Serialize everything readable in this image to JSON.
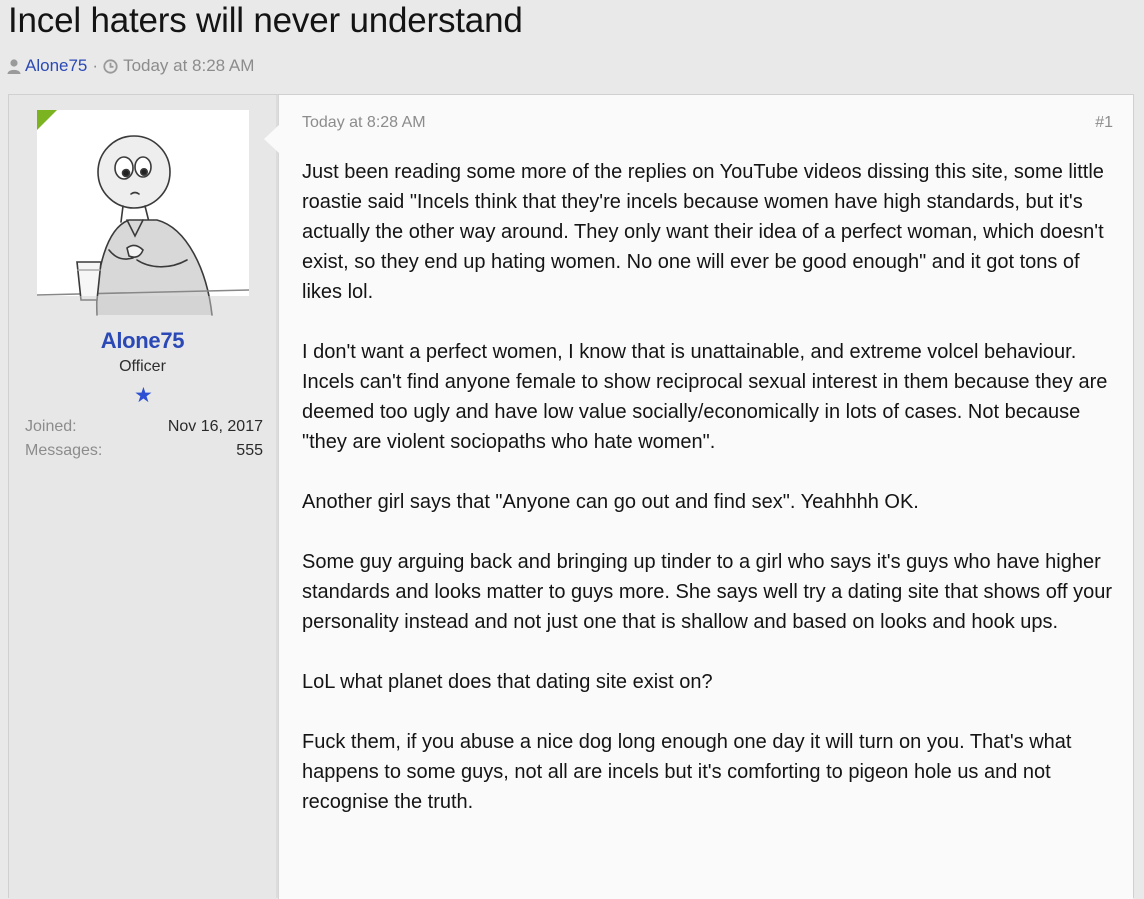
{
  "thread": {
    "title": "Incel haters will never understand",
    "author": "Alone75",
    "separator": "·",
    "date": "Today at 8:28 AM"
  },
  "user_panel": {
    "username": "Alone75",
    "user_title": "Officer",
    "rank_star": "★",
    "joined_label": "Joined:",
    "joined_value": "Nov 16, 2017",
    "messages_label": "Messages:",
    "messages_value": "555",
    "online_color": "#7bb321"
  },
  "post": {
    "date": "Today at 8:28 AM",
    "number": "#1",
    "paragraphs": [
      "Just been reading some more of the replies on YouTube videos dissing this site, some little roastie said \"Incels think that they're incels because women have high standards, but it's actually the other way around. They only want their idea of a perfect woman, which doesn't exist, so they end up hating women. No one will ever be good enough\" and it got tons of likes lol.",
      "I don't want a perfect women, I know that is unattainable, and extreme volcel behaviour. Incels can't find anyone female to show reciprocal sexual interest in them because they are deemed too ugly and have low value socially/economically in lots of cases. Not because \"they are violent sociopaths who hate women\".",
      "Another girl says that \"Anyone can go out and find sex\". Yeahhhh OK.",
      "Some guy arguing back and bringing up tinder to a girl who says it's guys who have higher standards and looks matter to guys more. She says well try a dating site that shows off your personality instead and not just one that is shallow and based on looks and hook ups.",
      "LoL what planet does that dating site exist on?",
      "Fuck them, if you abuse a nice dog long enough one day it will turn on you. That's what happens to some guys, not all are incels but it's comforting to pigeon hole us and not recognise the truth."
    ]
  },
  "colors": {
    "link": "#2b49b6",
    "muted": "#8c8c8c",
    "page_bg": "#e9e9e9",
    "message_bg": "#fafafa"
  },
  "icons": {
    "author": "user-icon",
    "date": "clock-icon"
  }
}
